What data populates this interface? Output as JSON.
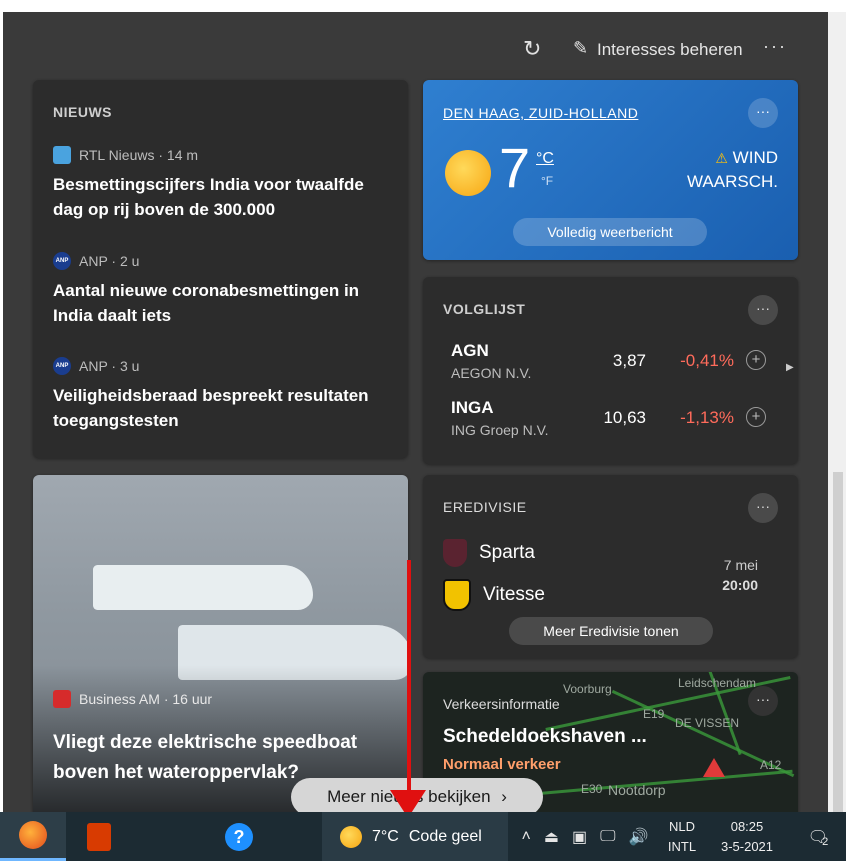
{
  "topbar": {
    "refresh_icon": "refresh-icon",
    "manage_label": "Interesses beheren",
    "more_label": "···"
  },
  "news": {
    "header": "NIEUWS",
    "items": [
      {
        "source": "RTL Nieuws · 14 m",
        "headline": "Besmettingscijfers India voor twaalfde dag op rij boven de 300.000"
      },
      {
        "source": "ANP · 2 u",
        "headline": "Aantal nieuwe coronabesmettingen in India daalt iets"
      },
      {
        "source": "ANP · 3 u",
        "headline": "Veiligheidsberaad bespreekt resultaten toegangstesten"
      }
    ],
    "anp_logo_text": "ANP"
  },
  "weather": {
    "location": "DEN HAAG, ZUID-HOLLAND",
    "temperature": "7",
    "unit_c": "°C",
    "unit_f": "°F",
    "warning_line1": "WIND",
    "warning_line2": "WAARSCH.",
    "forecast_button": "Volledig weerbericht",
    "more": "···",
    "accent": "#2a78c8"
  },
  "watchlist": {
    "header": "VOLGLIJST",
    "more": "···",
    "stocks": [
      {
        "symbol": "AGN",
        "name": "AEGON N.V.",
        "price": "3,87",
        "change": "-0,41%"
      },
      {
        "symbol": "INGA",
        "name": "ING Groep N.V.",
        "price": "10,63",
        "change": "-1,13%"
      }
    ],
    "add": "+",
    "next": "▶",
    "negative_color": "#ff6b5b"
  },
  "eredivisie": {
    "header": "EREDIVISIE",
    "more": "···",
    "home_team": "Sparta",
    "away_team": "Vitesse",
    "date": "7 mei",
    "time": "20:00",
    "more_button": "Meer Eredivisie tonen"
  },
  "traffic": {
    "label": "Verkeersinformatie",
    "title": "Schedeldoekshaven ...",
    "status": "Normaal verkeer",
    "more": "···",
    "map_labels": [
      "Leidschendam",
      "DE VISSEN",
      "Voorburg",
      "Nootdorp",
      "A12",
      "E19",
      "E30"
    ]
  },
  "photo_article": {
    "source": "Business AM · 16 uur",
    "headline": "Vliegt deze elektrische speedboat boven het wateroppervlak?"
  },
  "more_news_button": "Meer nieuws bekijken",
  "more_news_chevron": "›",
  "taskbar": {
    "weather_temp": "7°C",
    "weather_text": "Code geel",
    "help_label": "?",
    "lang_top": "NLD",
    "lang_bottom": "INTL",
    "time": "08:25",
    "date": "3-5-2021",
    "notification_count": "2",
    "tray_icons": [
      "chevron-up-icon",
      "usb-icon",
      "camera-icon",
      "network-icon",
      "volume-icon"
    ]
  }
}
